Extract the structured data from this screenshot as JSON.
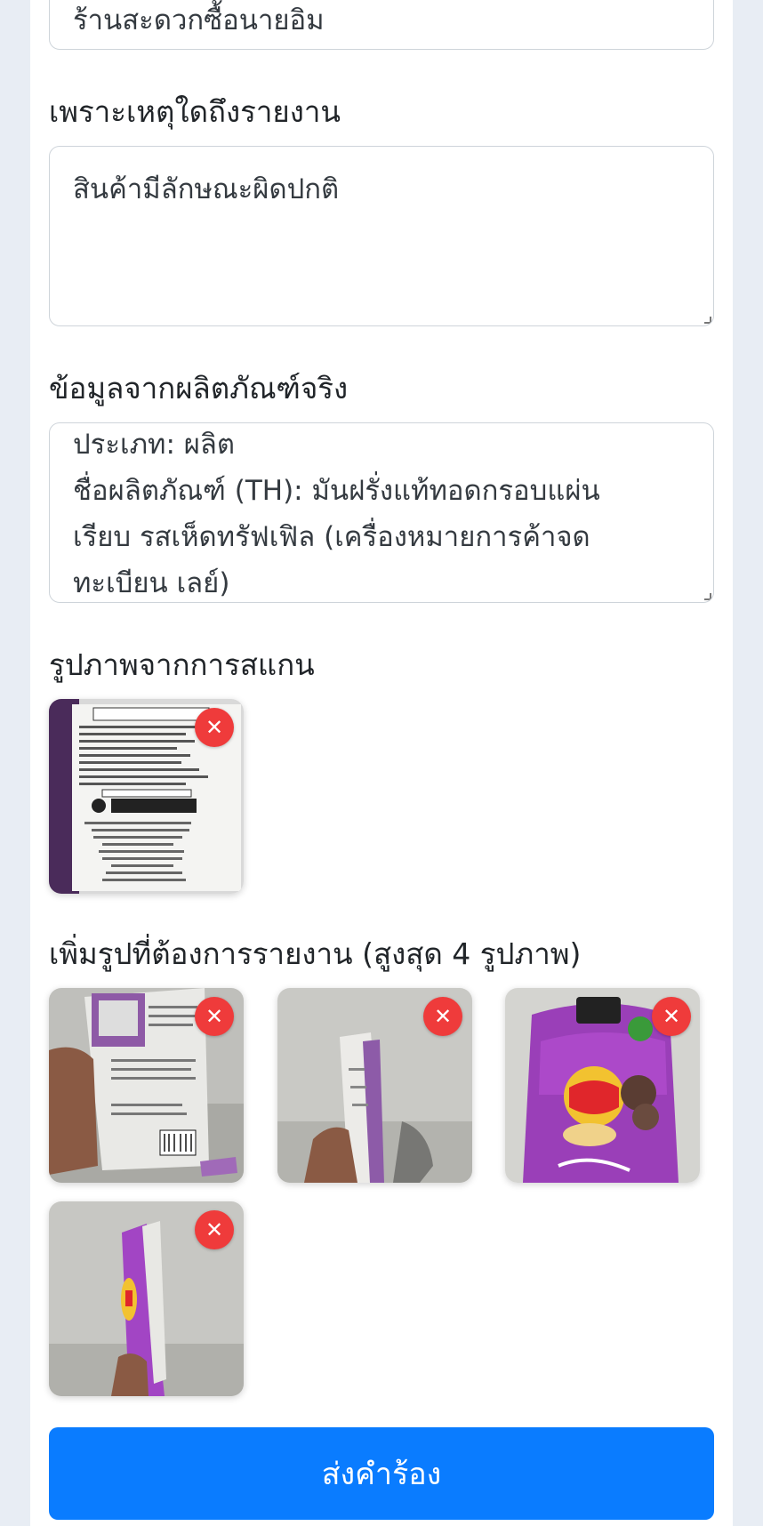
{
  "shop_field": {
    "value": "ร้านสะดวกซื้อนายอิม"
  },
  "reason": {
    "label": "เพราะเหตุใดถึงรายงาน",
    "value": "สินค้ามีลักษณะผิดปกติ"
  },
  "product_info": {
    "label": "ข้อมูลจากผลิตภัณฑ์จริง",
    "lines": [
      "ประเภท: ผลิต",
      "ชื่อผลิตภัณฑ์ (TH): มันฝรั่งแท้ทอดกรอบแผ่น",
      "เรียบ รสเห็ดทรัฟเฟิล (เครื่องหมายการค้าจด",
      "ทะเบียน เลย์)"
    ]
  },
  "scan_images": {
    "label": "รูปภาพจากการสแกน",
    "items": [
      {
        "image": "pepsico-label-back"
      }
    ]
  },
  "report_images": {
    "label": "เพิ่มรูปที่ต้องการรายงาน (สูงสุด 4 รูปภาพ)",
    "items": [
      {
        "image": "chip-bag-back-hand"
      },
      {
        "image": "chip-bag-side-hand"
      },
      {
        "image": "lays-truffle-bag-front"
      },
      {
        "image": "chip-bag-side-purple-hand"
      }
    ]
  },
  "remove_icon": "close-icon",
  "submit_label": "ส่งคำร้อง",
  "colors": {
    "primary": "#0a7cff",
    "remove": "#ef3b3b",
    "border": "#ced4da"
  }
}
